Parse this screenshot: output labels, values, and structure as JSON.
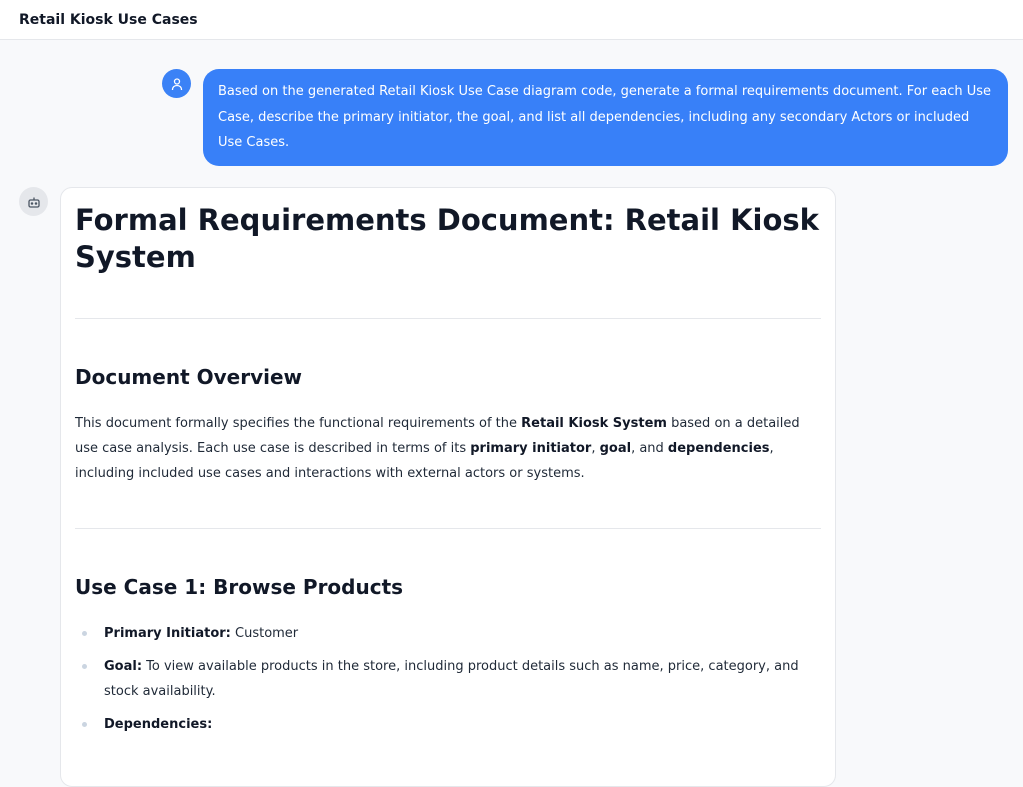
{
  "header": {
    "title": "Retail Kiosk Use Cases"
  },
  "user_message": "Based on the generated Retail Kiosk Use Case diagram code, generate a formal requirements document. For each Use Case, describe the primary initiator, the goal, and list all dependencies, including any secondary Actors or included Use Cases.",
  "doc": {
    "title": "Formal Requirements Document: Retail Kiosk System",
    "overview_heading": "Document Overview",
    "overview": {
      "t1": "This document formally specifies the functional requirements of the ",
      "b1": "Retail Kiosk System",
      "t2": " based on a detailed use case analysis. Each use case is described in terms of its ",
      "b2": "primary initiator",
      "t3": ", ",
      "b3": "goal",
      "t4": ", and ",
      "b4": "dependencies",
      "t5": ", including included use cases and interactions with external actors or systems."
    },
    "uc1_heading": "Use Case 1: Browse Products",
    "uc1": [
      {
        "label": "Primary Initiator:",
        "text": " Customer"
      },
      {
        "label": "Goal:",
        "text": " To view available products in the store, including product details such as name, price, category, and stock availability."
      },
      {
        "label": "Dependencies:",
        "text": ""
      }
    ]
  }
}
